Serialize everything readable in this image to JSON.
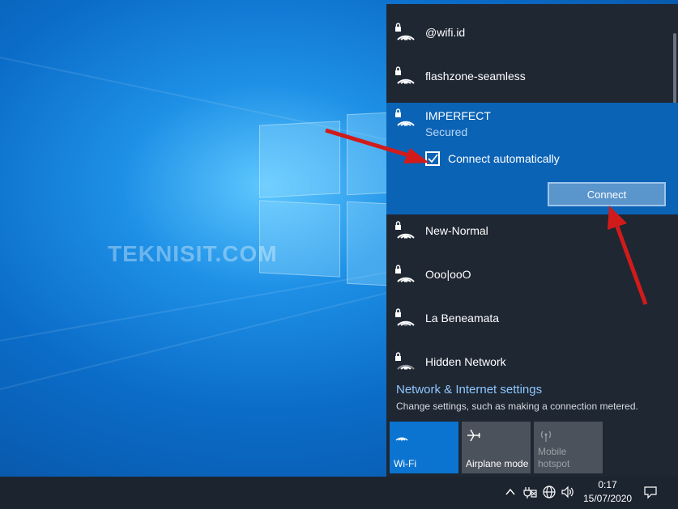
{
  "desktop": {
    "watermark": "TEKNISIT.COM"
  },
  "networks_top": [
    {
      "name": "@wifi.id",
      "icon": "wifi-secured-icon"
    },
    {
      "name": "flashzone-seamless",
      "icon": "wifi-secured-icon"
    }
  ],
  "expanded_network": {
    "name": "IMPERFECT",
    "status": "Secured",
    "connect_automatically_label": "Connect automatically",
    "connect_automatically_checked": true,
    "connect_label": "Connect"
  },
  "networks_bottom": [
    {
      "name": "New-Normal",
      "icon": "wifi-secured-icon"
    },
    {
      "name": "Ooo|ooO",
      "icon": "wifi-secured-icon"
    },
    {
      "name": "La Beneamata",
      "icon": "wifi-secured-icon"
    },
    {
      "name": "Hidden Network",
      "icon": "wifi-secured-icon"
    }
  ],
  "settings": {
    "link": "Network & Internet settings",
    "description": "Change settings, such as making a connection metered."
  },
  "quick_actions": {
    "wifi": "Wi-Fi",
    "airplane": "Airplane mode",
    "hotspot": "Mobile\nhotspot"
  },
  "taskbar": {
    "time": "0:17",
    "date": "15/07/2020"
  },
  "colors": {
    "panel_bg": "#1f2733",
    "accent": "#0b63b6",
    "tile_active": "#0b74d1",
    "arrow": "#d11b1b"
  }
}
